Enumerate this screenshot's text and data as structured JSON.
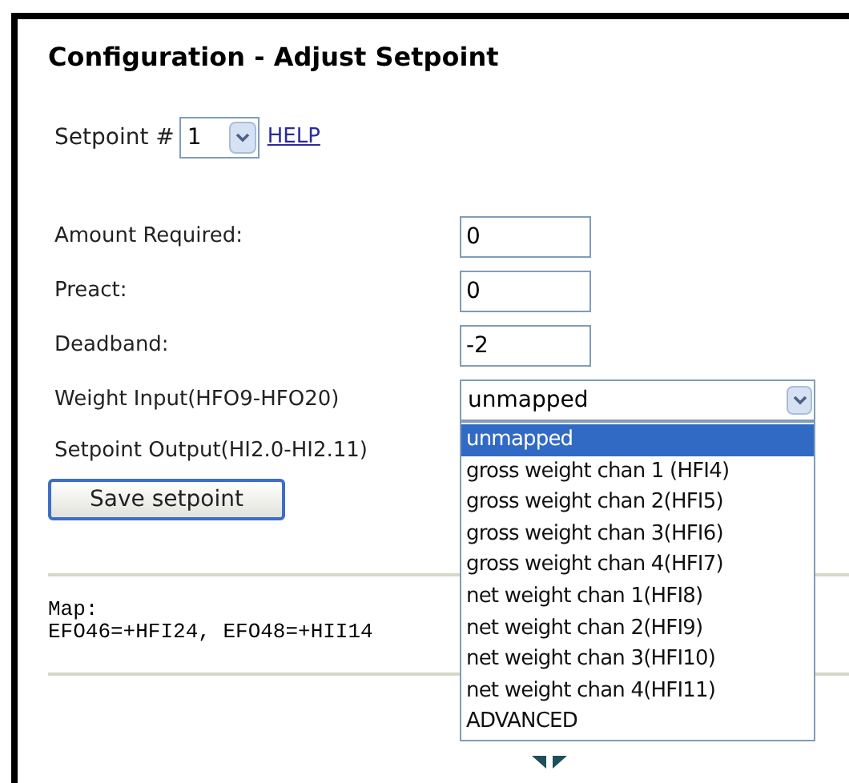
{
  "title": "Configuration - Adjust Setpoint",
  "setpoint": {
    "label": "Setpoint #",
    "value": "1",
    "help": "HELP"
  },
  "fields": [
    {
      "kind": "text",
      "label": "Amount Required:",
      "value": "0"
    },
    {
      "kind": "text",
      "label": "Preact:",
      "value": "0"
    },
    {
      "kind": "text",
      "label": "Deadband:",
      "value": "-2"
    },
    {
      "kind": "select",
      "label": "Weight Input(HFO9-HFO20)",
      "value": "unmapped",
      "expanded": true,
      "options": [
        {
          "label": "unmapped",
          "selected": true
        },
        {
          "label": "gross weight chan 1 (HFI4)",
          "selected": false
        },
        {
          "label": "gross weight chan 2(HFI5)",
          "selected": false
        },
        {
          "label": "gross weight chan 3(HFI6)",
          "selected": false
        },
        {
          "label": "gross weight chan 4(HFI7)",
          "selected": false
        },
        {
          "label": "net weight chan 1(HFI8)",
          "selected": false
        },
        {
          "label": "net weight chan 2(HFI9)",
          "selected": false
        },
        {
          "label": "net weight chan 3(HFI10)",
          "selected": false
        },
        {
          "label": "net weight chan 4(HFI11)",
          "selected": false
        },
        {
          "label": "ADVANCED",
          "selected": false
        }
      ]
    },
    {
      "kind": "label",
      "label": "Setpoint Output(HI2.0-HI2.11)"
    }
  ],
  "save_button": "Save setpoint",
  "map": {
    "heading": "Map:",
    "text": "EFO46=+HFI24, EFO48=+HII14"
  }
}
